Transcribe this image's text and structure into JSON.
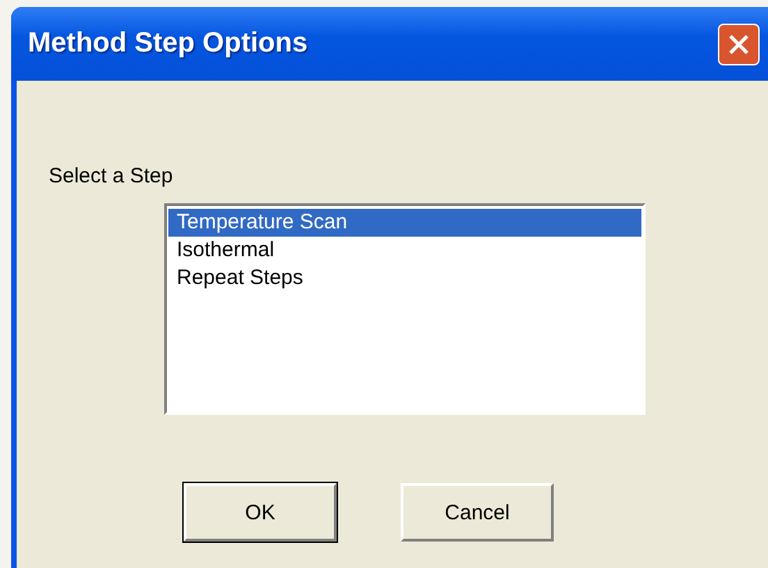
{
  "window": {
    "title": "Method Step Options"
  },
  "prompt": "Select a Step",
  "steps": [
    {
      "label": "Temperature Scan",
      "selected": true
    },
    {
      "label": "Isothermal",
      "selected": false
    },
    {
      "label": "Repeat Steps",
      "selected": false
    }
  ],
  "buttons": [
    {
      "label": "OK",
      "default": true
    },
    {
      "label": "Cancel",
      "default": false
    }
  ]
}
